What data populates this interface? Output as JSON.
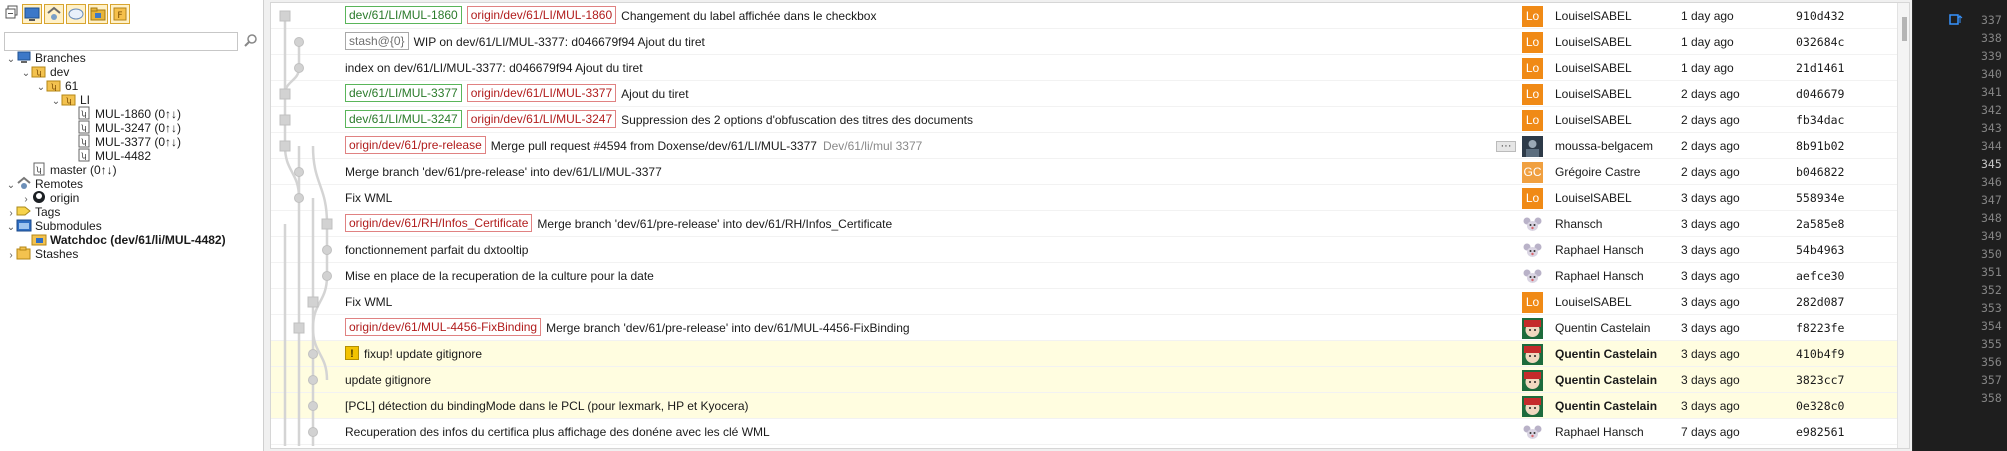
{
  "left_panel": {
    "toolbar_icons": [
      "collapse-all-icon",
      "repository-view-icon",
      "remote-view-icon",
      "tags-view-icon",
      "branch-folder-icon",
      "submodule-view-icon"
    ],
    "filter_placeholder": "",
    "tree": [
      {
        "label": "Branches",
        "icon": "branches-icon",
        "expanded": true
      },
      {
        "label": "dev",
        "icon": "folder-icon",
        "expanded": true
      },
      {
        "label": "61",
        "icon": "folder-icon",
        "expanded": true
      },
      {
        "label": "LI",
        "icon": "folder-icon",
        "expanded": true
      },
      {
        "label": "MUL-1860 (0↑↓)",
        "icon": "branch-icon"
      },
      {
        "label": "MUL-3247 (0↑↓)",
        "icon": "branch-icon"
      },
      {
        "label": "MUL-3377 (0↑↓)",
        "icon": "branch-icon"
      },
      {
        "label": "MUL-4482",
        "icon": "branch-icon"
      },
      {
        "label": "master (0↑↓)",
        "icon": "branch-icon"
      },
      {
        "label": "Remotes",
        "icon": "remotes-icon",
        "expanded": true
      },
      {
        "label": "origin",
        "icon": "github-icon",
        "expanded": false
      },
      {
        "label": "Tags",
        "icon": "tag-icon",
        "expanded": false
      },
      {
        "label": "Submodules",
        "icon": "submodules-icon",
        "expanded": true
      },
      {
        "label": "Watchdoc (dev/61/li/MUL-4482)",
        "icon": "submodule-folder-icon",
        "bold": true
      },
      {
        "label": "Stashes",
        "icon": "stashes-icon",
        "expanded": false
      }
    ]
  },
  "colors": {
    "local_branch": "#2a7a2a",
    "remote_branch": "#b11d1d",
    "highlight_row": "#fffde0",
    "graph_line": "#d4d4d4"
  },
  "commits": [
    {
      "badges": [
        {
          "text": "dev/61/LI/MUL-1860",
          "kind": "local"
        },
        {
          "text": "origin/dev/61/LI/MUL-1860",
          "kind": "remote"
        }
      ],
      "message": "Changement du label affichée dans le checkbox",
      "author": "LouiselSABEL",
      "avatar": "Lo",
      "date": "1 day ago",
      "sha": "910d432"
    },
    {
      "badges": [
        {
          "text": "stash@{0}",
          "kind": "stash"
        }
      ],
      "message": "WIP on dev/61/LI/MUL-3377: d046679f94 Ajout du tiret",
      "author": "LouiselSABEL",
      "avatar": "Lo",
      "date": "1 day ago",
      "sha": "032684c"
    },
    {
      "badges": [],
      "message": "index on dev/61/LI/MUL-3377: d046679f94 Ajout du tiret",
      "author": "LouiselSABEL",
      "avatar": "Lo",
      "date": "1 day ago",
      "sha": "21d1461"
    },
    {
      "badges": [
        {
          "text": "dev/61/LI/MUL-3377",
          "kind": "local"
        },
        {
          "text": "origin/dev/61/LI/MUL-3377",
          "kind": "remote"
        }
      ],
      "message": "Ajout du tiret",
      "author": "LouiselSABEL",
      "avatar": "Lo",
      "date": "2 days ago",
      "sha": "d046679"
    },
    {
      "badges": [
        {
          "text": "dev/61/LI/MUL-3247",
          "kind": "local"
        },
        {
          "text": "origin/dev/61/LI/MUL-3247",
          "kind": "remote"
        }
      ],
      "message": "Suppression des 2 options d'obfuscation des titres des documents",
      "author": "LouiselSABEL",
      "avatar": "Lo",
      "date": "2 days ago",
      "sha": "fb34dac"
    },
    {
      "badges": [
        {
          "text": "origin/dev/61/pre-release",
          "kind": "remote"
        }
      ],
      "message": "Merge pull request #4594 from Doxense/dev/61/LI/MUL-3377",
      "sub": "Dev/61/li/mul 3377",
      "dots": "···",
      "author": "moussa-belgacem",
      "avatar": "",
      "date": "2 days ago",
      "sha": "8b91b02"
    },
    {
      "badges": [],
      "message": "Merge branch 'dev/61/pre-release' into dev/61/LI/MUL-3377",
      "author": "Grégoire Castre",
      "avatar": "GC",
      "date": "2 days ago",
      "sha": "b046822"
    },
    {
      "badges": [],
      "message": "Fix WML",
      "author": "LouiselSABEL",
      "avatar": "Lo",
      "date": "3 days ago",
      "sha": "558934e"
    },
    {
      "badges": [
        {
          "text": "origin/dev/61/RH/Infos_Certificate",
          "kind": "remote"
        }
      ],
      "message": "Merge branch 'dev/61/pre-release' into dev/61/RH/Infos_Certificate",
      "author": "Rhansch",
      "avatar": "",
      "date": "3 days ago",
      "sha": "2a585e8"
    },
    {
      "badges": [],
      "message": "fonctionnement parfait du dxtooltip",
      "author": "Raphael Hansch",
      "avatar": "",
      "date": "3 days ago",
      "sha": "54b4963"
    },
    {
      "badges": [],
      "message": "Mise en place de la recuperation de la culture pour la date",
      "author": "Raphael Hansch",
      "avatar": "",
      "date": "3 days ago",
      "sha": "aefce30"
    },
    {
      "badges": [],
      "message": "Fix WML",
      "author": "LouiselSABEL",
      "avatar": "Lo",
      "date": "3 days ago",
      "sha": "282d087"
    },
    {
      "badges": [
        {
          "text": "origin/dev/61/MUL-4456-FixBinding",
          "kind": "remote"
        }
      ],
      "message": "Merge branch 'dev/61/pre-release' into dev/61/MUL-4456-FixBinding",
      "author": "Quentin Castelain",
      "avatar": "",
      "date": "3 days ago",
      "sha": "f8223fe"
    },
    {
      "badges": [],
      "warn": "!",
      "message": "fixup! update gitignore",
      "author": "Quentin Castelain",
      "avatar": "",
      "date": "3 days ago",
      "sha": "410b4f9",
      "highlight": true
    },
    {
      "badges": [],
      "message": "update gitignore",
      "author": "Quentin Castelain",
      "avatar": "",
      "date": "3 days ago",
      "sha": "3823cc7",
      "highlight": true
    },
    {
      "badges": [],
      "message": "[PCL] détection du bindingMode dans le PCL (pour lexmark, HP et Kyocera)",
      "author": "Quentin Castelain",
      "avatar": "",
      "date": "3 days ago",
      "sha": "0e328c0",
      "highlight": true
    },
    {
      "badges": [],
      "message": "Recuperation des infos du certifica plus affichage des donéne avec les clé WML",
      "author": "Raphael Hansch",
      "avatar": "",
      "date": "7 days ago",
      "sha": "e982561"
    }
  ],
  "editor": {
    "line_numbers": [
      "337",
      "338",
      "339",
      "340",
      "341",
      "342",
      "343",
      "344",
      "345",
      "346",
      "347",
      "348",
      "349",
      "350",
      "351",
      "352",
      "353",
      "354",
      "355",
      "356",
      "357",
      "358"
    ],
    "current_line": "345"
  }
}
